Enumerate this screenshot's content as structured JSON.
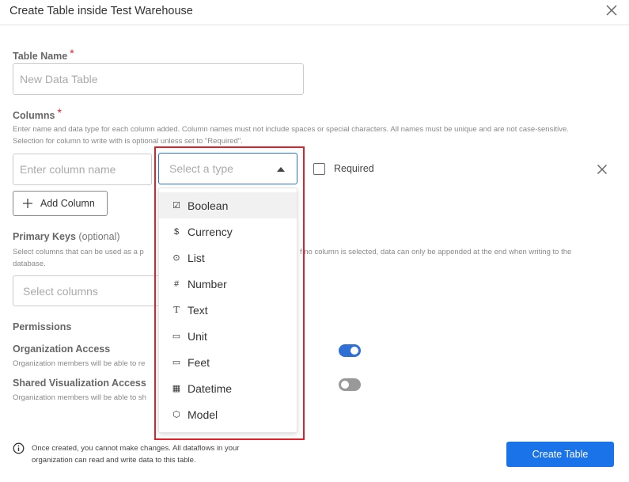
{
  "dialog": {
    "title": "Create Table inside Test Warehouse"
  },
  "table_name": {
    "label": "Table Name",
    "required_mark": "*",
    "placeholder": "New Data Table"
  },
  "columns": {
    "label": "Columns",
    "required_mark": "*",
    "help_line1": "Enter name and data type for each column added. Column names must not include spaces or special characters. All names must be unique and are not case-sensitive.",
    "help_line2": "Selection for column to write with is optional unless set to \"Required\".",
    "name_placeholder": "Enter column name",
    "type_placeholder": "Select a type",
    "required_label": "Required",
    "add_column_label": "Add Column"
  },
  "type_options": [
    {
      "label": "Boolean",
      "icon": "checkbox-icon",
      "glyph": "☑"
    },
    {
      "label": "Currency",
      "icon": "dollar-icon",
      "glyph": "$"
    },
    {
      "label": "List",
      "icon": "radio-icon",
      "glyph": "⊙"
    },
    {
      "label": "Number",
      "icon": "hash-icon",
      "glyph": "#"
    },
    {
      "label": "Text",
      "icon": "text-icon",
      "glyph": "T"
    },
    {
      "label": "Unit",
      "icon": "ruler-icon",
      "glyph": "▭"
    },
    {
      "label": "Feet",
      "icon": "ruler-icon",
      "glyph": "▭"
    },
    {
      "label": "Datetime",
      "icon": "calendar-icon",
      "glyph": "▦"
    },
    {
      "label": "Model",
      "icon": "cube-icon",
      "glyph": "⬡"
    }
  ],
  "primary_keys": {
    "label": "Primary Keys",
    "optional_label": "(optional)",
    "help_left1": "Select columns that can be used as a p",
    "help_right1": "f no column is selected, data can only be appended at the end when writing to the",
    "help_line2": "database.",
    "placeholder": "Select columns"
  },
  "permissions": {
    "label": "Permissions",
    "org_access_label": "Organization Access",
    "org_access_help": "Organization members will be able to re",
    "org_access_on": true,
    "shared_vis_label": "Shared Visualization Access",
    "shared_vis_help": "Organization members will be able to sh",
    "shared_vis_on": false
  },
  "footer": {
    "note_line1": "Once created, you cannot make changes. All dataflows in your",
    "note_line2": "organization can read and write data to this table.",
    "create_label": "Create Table"
  },
  "colors": {
    "accent": "#1a73e8",
    "toggle_on": "#2f6fd6",
    "toggle_off": "#999999",
    "required": "#e0212a",
    "annotation_box": "#e0212a"
  }
}
